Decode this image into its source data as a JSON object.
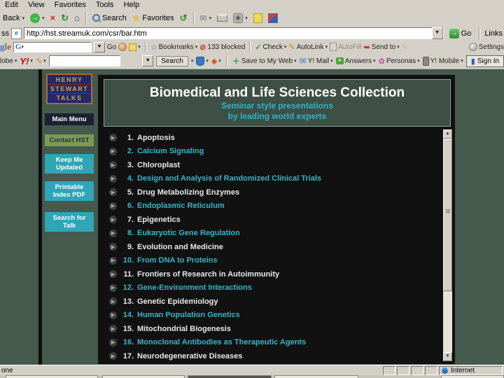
{
  "browser": {
    "menu": [
      "Edit",
      "View",
      "Favorites",
      "Tools",
      "Help"
    ],
    "toolbar": {
      "back_label": "Back",
      "search_label": "Search",
      "favorites_label": "Favorites"
    },
    "address": {
      "label_trunc": "ss",
      "page_icon_glyph": "e",
      "url": "http://hst.streamuk.com/csr/bar.htm",
      "go_label": "Go",
      "links_label": "Links"
    },
    "google": {
      "logo_g": "g",
      "logo_l": "l",
      "logo_e": "e",
      "combo_mark": "G",
      "go_label": "Go",
      "bookmarks_label": "Bookmarks",
      "blocked_label": "133 blocked",
      "check_label": "Check",
      "autolink_label": "AutoLink",
      "autofill_label": "AutoFill",
      "sendto_label": "Send to",
      "settings_label": "Settings"
    },
    "yahoo": {
      "left_trunc": "lobe",
      "logo": "Y!",
      "search_label": "Search",
      "save_label": "Save to My Web",
      "mail_label": "Y! Mail",
      "answers_label": "Answers",
      "personas_label": "Personas",
      "mobile_label": "Y! Mobile",
      "signin_label": "Sign In"
    },
    "status": {
      "left": "one",
      "zone": "Internet"
    }
  },
  "page": {
    "logo": [
      "HENRY",
      "STEWART",
      "TALKS"
    ],
    "sidebar": {
      "main_menu": "Main Menu",
      "contact": "Contact HST",
      "keep_updated_1": "Keep Me",
      "keep_updated_2": "Updated",
      "printable_1": "Printable",
      "printable_2": "Index PDF",
      "search_talk_1": "Search for",
      "search_talk_2": "Talk"
    },
    "header": {
      "title": "Biomedical and Life Sciences Collection",
      "subtitle_line1": "Seminar style presentations",
      "subtitle_line2": "by leading world experts"
    },
    "list": [
      {
        "num": "1.",
        "title": "Apoptosis"
      },
      {
        "num": "2.",
        "title": "Calcium Signaling"
      },
      {
        "num": "3.",
        "title": "Chloroplast"
      },
      {
        "num": "4.",
        "title": "Design and Analysis of Randomized Clinical Trials"
      },
      {
        "num": "5.",
        "title": "Drug Metabolizing Enzymes"
      },
      {
        "num": "6.",
        "title": "Endoplasmic Reticulum"
      },
      {
        "num": "7.",
        "title": "Epigenetics"
      },
      {
        "num": "8.",
        "title": "Eukaryotic Gene Regulation"
      },
      {
        "num": "9.",
        "title": "Evolution and Medicine"
      },
      {
        "num": "10.",
        "title": "From DNA to Proteins"
      },
      {
        "num": "11.",
        "title": "Frontiers of Research in Autoimmunity"
      },
      {
        "num": "12.",
        "title": "Gene-Environment Interactions"
      },
      {
        "num": "13.",
        "title": "Genetic Epidemiology"
      },
      {
        "num": "14.",
        "title": "Human Population Genetics"
      },
      {
        "num": "15.",
        "title": "Mitochondrial Biogenesis"
      },
      {
        "num": "16.",
        "title": "Monoclonal Antibodies as Therapeutic Agents"
      },
      {
        "num": "17.",
        "title": "Neurodegenerative Diseases"
      }
    ]
  },
  "colors": {
    "page_bg": "#45594d",
    "header_bg": "#3e4f46",
    "list_teal": "#35b6c8",
    "button_teal": "#2fa5b7",
    "button_olive": "#7d9a51",
    "button_navy": "#1b2132",
    "logo_navy": "#23286a",
    "logo_gold": "#d2a63c",
    "logo_border": "#b06a28",
    "chrome_gray": "#d4d0c8"
  }
}
